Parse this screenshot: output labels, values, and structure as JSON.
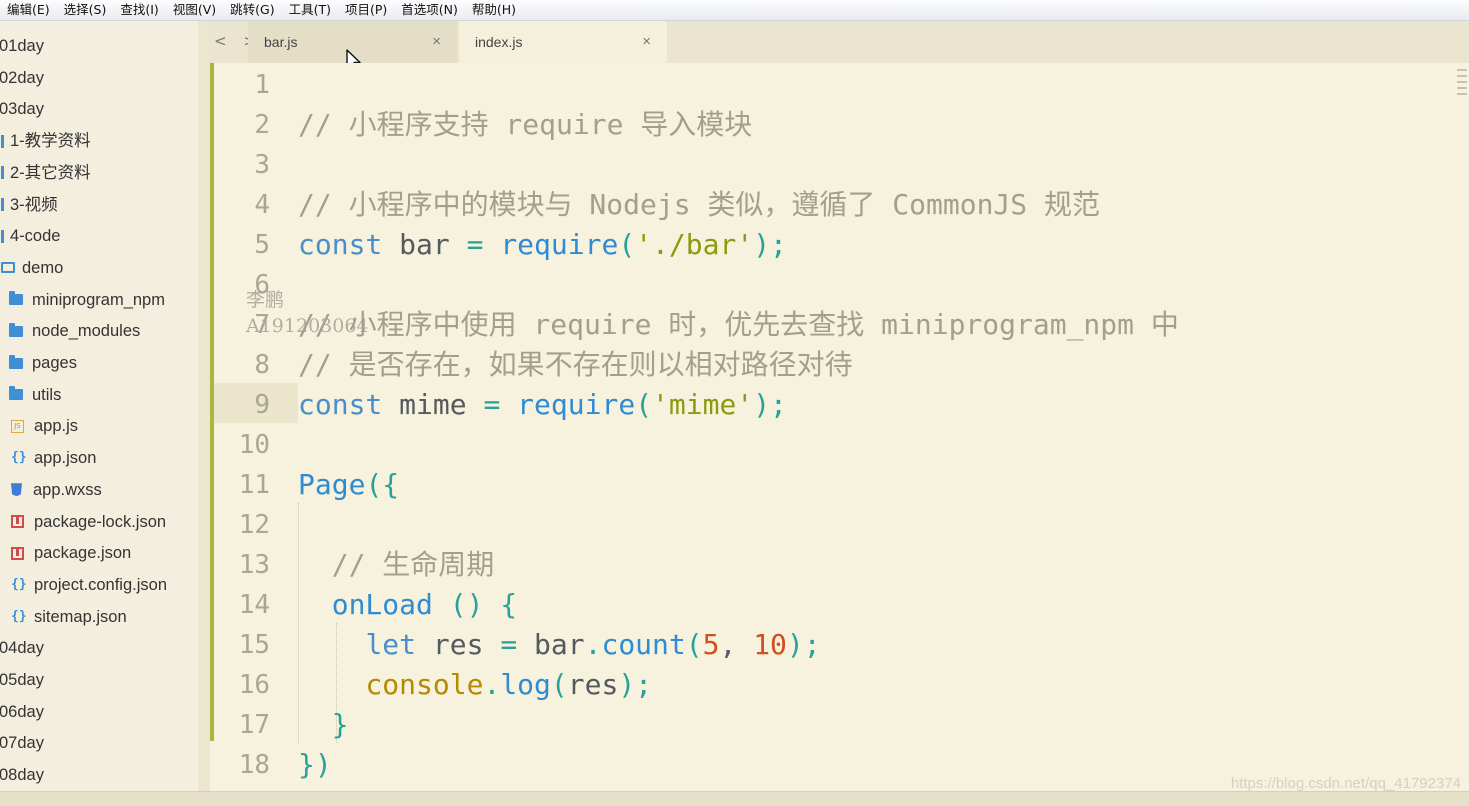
{
  "menu": [
    "编辑(E)",
    "选择(S)",
    "查找(I)",
    "视图(V)",
    "跳转(G)",
    "工具(T)",
    "项目(P)",
    "首选项(N)",
    "帮助(H)"
  ],
  "sidebar": [
    {
      "label": "01day",
      "icon": "none"
    },
    {
      "label": "02day",
      "icon": "none"
    },
    {
      "label": "03day",
      "icon": "none"
    },
    {
      "label": "1-教学资料",
      "icon": "folder-bar"
    },
    {
      "label": "2-其它资料",
      "icon": "folder-bar"
    },
    {
      "label": "3-视频",
      "icon": "folder-bar"
    },
    {
      "label": "4-code",
      "icon": "folder-bar"
    },
    {
      "label": "demo",
      "icon": "folder-open"
    },
    {
      "label": "miniprogram_npm",
      "icon": "folder"
    },
    {
      "label": "node_modules",
      "icon": "folder"
    },
    {
      "label": "pages",
      "icon": "folder"
    },
    {
      "label": "utils",
      "icon": "folder"
    },
    {
      "label": "app.js",
      "icon": "js-file"
    },
    {
      "label": "app.json",
      "icon": "json-file"
    },
    {
      "label": "app.wxss",
      "icon": "css-file"
    },
    {
      "label": "package-lock.json",
      "icon": "package-file"
    },
    {
      "label": "package.json",
      "icon": "package-file"
    },
    {
      "label": "project.config.json",
      "icon": "json-file"
    },
    {
      "label": "sitemap.json",
      "icon": "json-file"
    },
    {
      "label": "04day",
      "icon": "none"
    },
    {
      "label": "05day",
      "icon": "none"
    },
    {
      "label": "06day",
      "icon": "none"
    },
    {
      "label": "07day",
      "icon": "none"
    },
    {
      "label": "08day",
      "icon": "none"
    }
  ],
  "tabs": [
    {
      "label": "bar.js",
      "active": false
    },
    {
      "label": "index.js",
      "active": true
    }
  ],
  "nav_arrows": "< >",
  "close_glyph": "×",
  "code": [
    {
      "n": "1",
      "tokens": []
    },
    {
      "n": "2",
      "tokens": [
        {
          "t": "// 小程序支持 require 导入模块",
          "c": "cmt"
        }
      ]
    },
    {
      "n": "3",
      "tokens": []
    },
    {
      "n": "4",
      "tokens": [
        {
          "t": "// 小程序中的模块与 Nodejs 类似，遵循了 CommonJS 规范",
          "c": "cmt"
        }
      ]
    },
    {
      "n": "5",
      "tokens": [
        {
          "t": "const",
          "c": "kw"
        },
        {
          "t": " bar ",
          "c": "id"
        },
        {
          "t": "=",
          "c": "punc"
        },
        {
          "t": " ",
          "c": "id"
        },
        {
          "t": "require",
          "c": "fn"
        },
        {
          "t": "(",
          "c": "punc"
        },
        {
          "t": "'./bar'",
          "c": "str"
        },
        {
          "t": ");",
          "c": "punc"
        }
      ]
    },
    {
      "n": "6",
      "tokens": []
    },
    {
      "n": "7",
      "tokens": [
        {
          "t": "// 小程序中使用 require 时，优先去查找 miniprogram_npm 中",
          "c": "cmt"
        }
      ]
    },
    {
      "n": "8",
      "tokens": [
        {
          "t": "// 是否存在，如果不存在则以相对路径对待",
          "c": "cmt"
        }
      ]
    },
    {
      "n": "9",
      "tokens": [
        {
          "t": "const",
          "c": "kw"
        },
        {
          "t": " mime ",
          "c": "id"
        },
        {
          "t": "=",
          "c": "punc"
        },
        {
          "t": " ",
          "c": "id"
        },
        {
          "t": "require",
          "c": "fn"
        },
        {
          "t": "(",
          "c": "punc"
        },
        {
          "t": "'mime'",
          "c": "str"
        },
        {
          "t": ");",
          "c": "punc"
        }
      ]
    },
    {
      "n": "10",
      "tokens": []
    },
    {
      "n": "11",
      "tokens": [
        {
          "t": "Page",
          "c": "page"
        },
        {
          "t": "({",
          "c": "punc"
        }
      ]
    },
    {
      "n": "12",
      "tokens": []
    },
    {
      "n": "13",
      "tokens": [
        {
          "t": "  // 生命周期",
          "c": "cmt"
        }
      ]
    },
    {
      "n": "14",
      "tokens": [
        {
          "t": "  ",
          "c": "id"
        },
        {
          "t": "onLoad",
          "c": "fn"
        },
        {
          "t": " () {",
          "c": "punc"
        }
      ]
    },
    {
      "n": "15",
      "tokens": [
        {
          "t": "    ",
          "c": "id"
        },
        {
          "t": "let",
          "c": "kw"
        },
        {
          "t": " res ",
          "c": "id"
        },
        {
          "t": "=",
          "c": "punc"
        },
        {
          "t": " bar",
          "c": "id"
        },
        {
          "t": ".",
          "c": "punc"
        },
        {
          "t": "count",
          "c": "fn"
        },
        {
          "t": "(",
          "c": "punc"
        },
        {
          "t": "5",
          "c": "num"
        },
        {
          "t": ", ",
          "c": "id"
        },
        {
          "t": "10",
          "c": "num"
        },
        {
          "t": ");",
          "c": "punc"
        }
      ]
    },
    {
      "n": "16",
      "tokens": [
        {
          "t": "    ",
          "c": "id"
        },
        {
          "t": "console",
          "c": "yel"
        },
        {
          "t": ".",
          "c": "punc"
        },
        {
          "t": "log",
          "c": "fn"
        },
        {
          "t": "(",
          "c": "punc"
        },
        {
          "t": "res",
          "c": "id"
        },
        {
          "t": ");",
          "c": "punc"
        }
      ]
    },
    {
      "n": "17",
      "tokens": [
        {
          "t": "  }",
          "c": "punc"
        }
      ]
    },
    {
      "n": "18",
      "tokens": [
        {
          "t": "})",
          "c": "punc"
        }
      ]
    }
  ],
  "current_line": "9",
  "watermark": {
    "name": "李鹏",
    "id": "A191203064",
    "url": "https://blog.csdn.net/qq_41792374"
  }
}
